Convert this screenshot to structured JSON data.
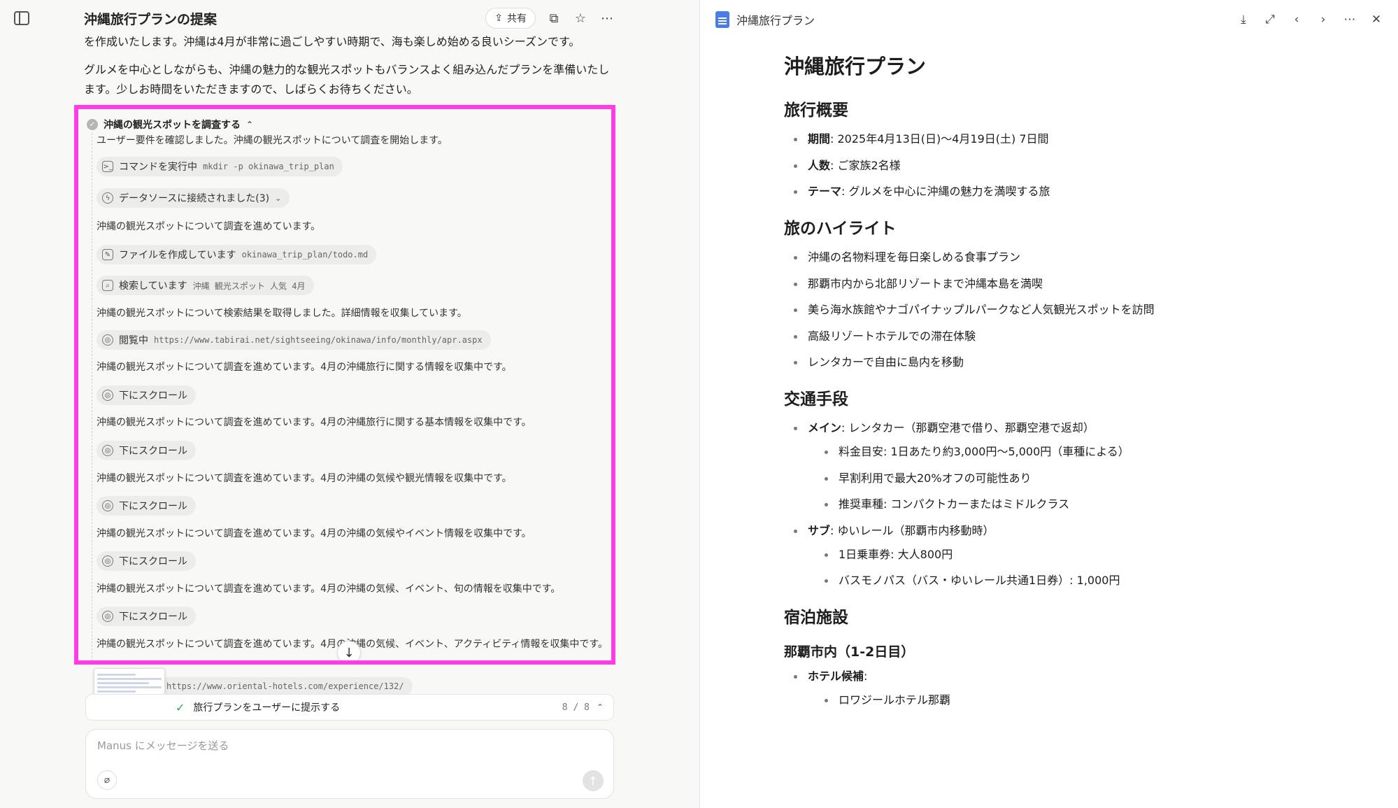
{
  "chat": {
    "title": "沖縄旅行プランの提案",
    "share_label": "共有",
    "intro": [
      "を作成いたします。沖縄は4月が非常に過ごしやすい時期で、海も楽しめ始める良いシーズンです。",
      "グルメを中心としながらも、沖縄の魅力的な観光スポットもバランスよく組み込んだプランを準備いたします。少しお時間をいただきますので、しばらくお待ちください。"
    ]
  },
  "task": {
    "title": "沖縄の観光スポットを調査する",
    "items": [
      {
        "kind": "text",
        "text": "ユーザー要件を確認しました。沖縄の観光スポットについて調査を開始します。"
      },
      {
        "kind": "pill",
        "icon": "terminal-icon",
        "glyph": ">_",
        "label": "コマンドを実行中",
        "code": "mkdir -p okinawa_trip_plan"
      },
      {
        "kind": "pill",
        "icon": "lightning-icon",
        "glyph": "ϟ",
        "label": "データソースに接続されました(3)",
        "code": "",
        "chevron": "⌄"
      },
      {
        "kind": "text",
        "text": "沖縄の観光スポットについて調査を進めています。"
      },
      {
        "kind": "pill",
        "icon": "edit-icon",
        "glyph": "✎",
        "label": "ファイルを作成しています",
        "code": "okinawa_trip_plan/todo.md"
      },
      {
        "kind": "pill",
        "icon": "search-icon",
        "glyph": "⌕",
        "label": "検索しています",
        "code": "沖縄 観光スポット 人気 4月"
      },
      {
        "kind": "text",
        "text": "沖縄の観光スポットについて検索結果を取得しました。詳細情報を収集しています。"
      },
      {
        "kind": "pill",
        "icon": "compass-icon",
        "glyph": "◎",
        "label": "閲覧中",
        "code": "https://www.tabirai.net/sightseeing/okinawa/info/monthly/apr.aspx"
      },
      {
        "kind": "text",
        "text": "沖縄の観光スポットについて調査を進めています。4月の沖縄旅行に関する情報を収集中です。"
      },
      {
        "kind": "pill",
        "icon": "compass-icon",
        "glyph": "◎",
        "label": "下にスクロール",
        "code": ""
      },
      {
        "kind": "text",
        "text": "沖縄の観光スポットについて調査を進めています。4月の沖縄旅行に関する基本情報を収集中です。"
      },
      {
        "kind": "pill",
        "icon": "compass-icon",
        "glyph": "◎",
        "label": "下にスクロール",
        "code": ""
      },
      {
        "kind": "text",
        "text": "沖縄の観光スポットについて調査を進めています。4月の沖縄の気候や観光情報を収集中です。"
      },
      {
        "kind": "pill",
        "icon": "compass-icon",
        "glyph": "◎",
        "label": "下にスクロール",
        "code": ""
      },
      {
        "kind": "text",
        "text": "沖縄の観光スポットについて調査を進めています。4月の沖縄の気候やイベント情報を収集中です。"
      },
      {
        "kind": "pill",
        "icon": "compass-icon",
        "glyph": "◎",
        "label": "下にスクロール",
        "code": ""
      },
      {
        "kind": "text",
        "text": "沖縄の観光スポットについて調査を進めています。4月の沖縄の気候、イベント、旬の情報を収集中です。"
      },
      {
        "kind": "pill",
        "icon": "compass-icon",
        "glyph": "◎",
        "label": "下にスクロール",
        "code": ""
      },
      {
        "kind": "text",
        "text": "沖縄の観光スポットについて調査を進めています。4月の沖縄の気候、イベント、アクティビティ情報を収集中です。"
      }
    ],
    "below_url": "https://www.oriental-hotels.com/experience/132/"
  },
  "step": {
    "label": "旅行プランをユーザーに提示する",
    "count": "8 / 8"
  },
  "composer": {
    "placeholder": "Manus にメッセージを送る"
  },
  "doc": {
    "header_title": "沖縄旅行プラン",
    "title": "沖縄旅行プラン",
    "sections": [
      {
        "heading": "旅行概要",
        "items": [
          {
            "bold": "期間",
            "text": ": 2025年4月13日(日)〜4月19日(土) 7日間"
          },
          {
            "bold": "人数",
            "text": ": ご家族2名様"
          },
          {
            "bold": "テーマ",
            "text": ": グルメを中心に沖縄の魅力を満喫する旅"
          }
        ]
      },
      {
        "heading": "旅のハイライト",
        "items": [
          {
            "bold": "",
            "text": "沖縄の名物料理を毎日楽しめる食事プラン"
          },
          {
            "bold": "",
            "text": "那覇市内から北部リゾートまで沖縄本島を満喫"
          },
          {
            "bold": "",
            "text": "美ら海水族館やナゴパイナップルパークなど人気観光スポットを訪問"
          },
          {
            "bold": "",
            "text": "高級リゾートホテルでの滞在体験"
          },
          {
            "bold": "",
            "text": "レンタカーで自由に島内を移動"
          }
        ]
      },
      {
        "heading": "交通手段",
        "items": [
          {
            "bold": "メイン",
            "text": ": レンタカー（那覇空港で借り、那覇空港で返却）",
            "sub": [
              "料金目安: 1日あたり約3,000円〜5,000円（車種による）",
              "早割利用で最大20%オフの可能性あり",
              "推奨車種: コンパクトカーまたはミドルクラス"
            ]
          },
          {
            "bold": "サブ",
            "text": ": ゆいレール（那覇市内移動時）",
            "sub": [
              "1日乗車券: 大人800円",
              "バスモノパス（バス・ゆいレール共通1日券）: 1,000円"
            ]
          }
        ]
      },
      {
        "heading": "宿泊施設",
        "subheading": "那覇市内（1-2日目）",
        "items": [
          {
            "bold": "ホテル候補",
            "text": ":",
            "sub": [
              "ロワジールホテル那覇"
            ]
          }
        ]
      }
    ]
  }
}
